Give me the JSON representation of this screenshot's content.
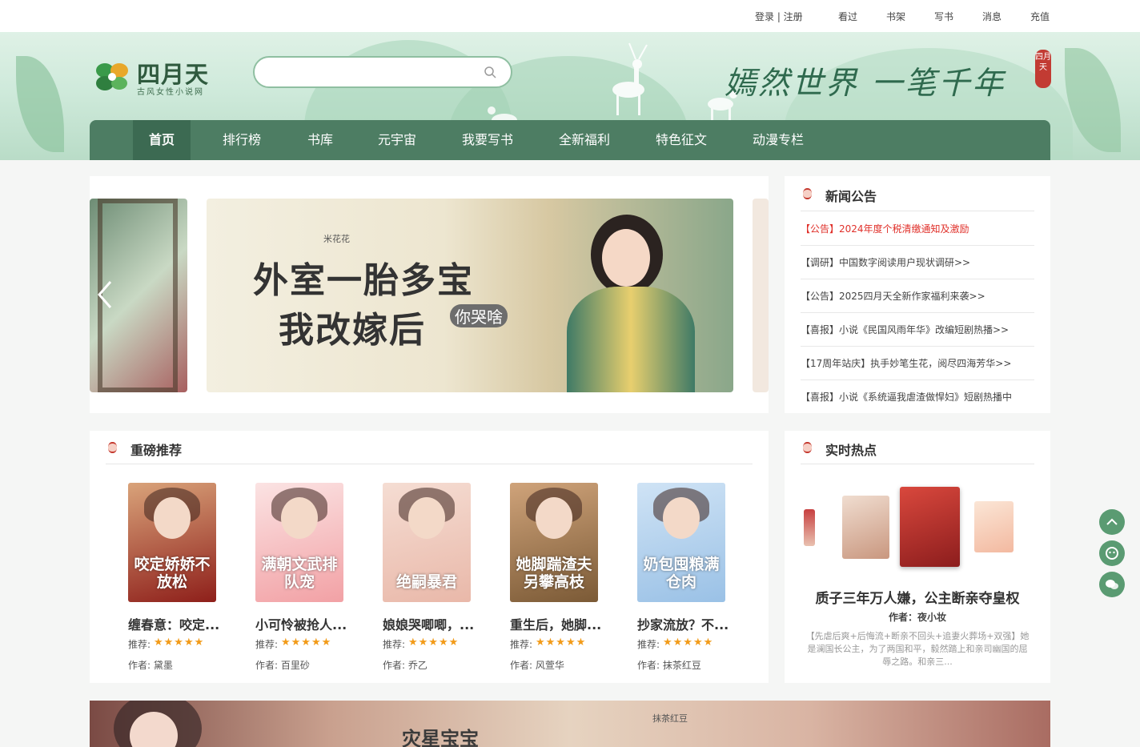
{
  "topbar": {
    "login": "登录 | 注册",
    "history": "看过",
    "shelf": "书架",
    "write": "写书",
    "messages": "消息",
    "recharge": "充值"
  },
  "logo": {
    "name": "四月天",
    "sub": "古风女性小说网"
  },
  "search": {
    "placeholder": ""
  },
  "slogan": "嫣然世界 一笔千年",
  "seal": "四月天",
  "nav": [
    "首页",
    "排行榜",
    "书库",
    "元宇宙",
    "我要写书",
    "全新福利",
    "特色征文",
    "动漫专栏"
  ],
  "banner": {
    "author": "米花花",
    "title_line1": "外室一胎多宝",
    "title_line2": "我改嫁后",
    "title_tag": "你哭啥"
  },
  "news": {
    "title": "新闻公告",
    "items": [
      "【公告】2024年度个税清缴通知及激励",
      "【调研】中国数字阅读用户现状调研>>",
      "【公告】2025四月天全新作家福利来袭>>",
      "【喜报】小说《民国风雨年华》改编短剧热播>>",
      "【17周年站庆】执手妙笔生花，阅尽四海芳华>>",
      "【喜报】小说《系统逼我虐渣做悍妇》短剧热播中"
    ]
  },
  "recommend": {
    "title": "重磅推荐",
    "rec_label": "推荐:",
    "author_label": "作者:",
    "stars": "★★★★★",
    "books": [
      {
        "title": "缠春意：咬定...",
        "author": "黛墨",
        "cover_text": "咬定娇娇不放松",
        "c1": "#d9a37a",
        "c2": "#8e1f1a"
      },
      {
        "title": "小可怜被抢人...",
        "author": "百里砂",
        "cover_text": "满朝文武排队宠",
        "c1": "#fbe3e3",
        "c2": "#f2a1a5"
      },
      {
        "title": "娘娘哭唧唧，...",
        "author": "乔乙",
        "cover_text": "绝嗣暴君",
        "c1": "#f5ddd3",
        "c2": "#e9b8a9"
      },
      {
        "title": "重生后，她脚...",
        "author": "风萱华",
        "cover_text": "她脚踹渣夫另攀高枝",
        "c1": "#cfa37a",
        "c2": "#7b5a36"
      },
      {
        "title": "抄家流放？不...",
        "author": "抹茶红豆",
        "cover_text": "奶包囤粮满仓肉",
        "c1": "#cfe3f5",
        "c2": "#9ac1e6"
      }
    ]
  },
  "hot": {
    "title": "实时热点",
    "book_title": "质子三年万人嫌，公主断亲夺皇权",
    "author": "作者：夜小妆",
    "desc": "【先虐后爽+后悔流+断亲不回头+追妻火葬场+双强】她是澜国长公主，为了两国和平，毅然踏上和亲司幽国的屈辱之路。和亲三..."
  },
  "bottom_banner": {
    "author": "抹茶红豆",
    "text": "灾星宝宝"
  }
}
